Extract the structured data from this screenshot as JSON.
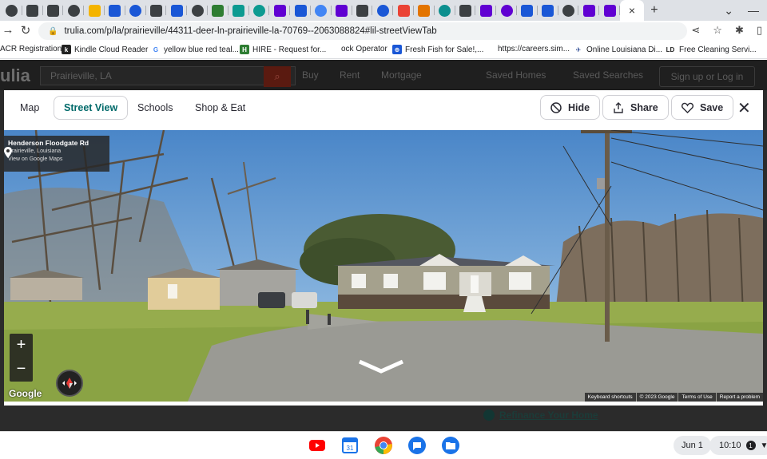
{
  "browser": {
    "tab_colors": [
      "#3c4043",
      "#3c4043",
      "#3c4043",
      "#3c4043",
      "#f4b400",
      "#1a57d6",
      "#1a57d6",
      "#3c4043",
      "#1a57d6",
      "#3c4043",
      "#2e7d32",
      "#0c9a91",
      "#0c9a91",
      "#6001d2",
      "#1a57d6",
      "#4285f4",
      "#6001d2",
      "#3c4043",
      "#1a57d6",
      "#ea4335",
      "#e37400",
      "#0c8f8f",
      "#3c4043",
      "#6001d2",
      "#6001d2",
      "#1a57d6",
      "#1a57d6",
      "#3c4043",
      "#6001d2",
      "#6001d2"
    ],
    "active_tab_close": "×",
    "new_tab": "+",
    "url_host": "trulia.com",
    "url_path": "/p/la/prairieville/44311-deer-ln-prairieville-la-70769--2063088824#lil-streetViewTab",
    "bookmarks": [
      {
        "label": "ACR Registration",
        "color": "#3c4043"
      },
      {
        "label": "Kindle Cloud Reader",
        "color": "#222222",
        "icon": "k"
      },
      {
        "label": "yellow blue red teal...",
        "color": "#4285f4",
        "icon": "G"
      },
      {
        "label": "HIRE - Request for...",
        "color": "#2e7d32",
        "icon": "H"
      },
      {
        "label": "ock Operator",
        "color": "#ffffff"
      },
      {
        "label": "Fresh Fish for Sale!,...",
        "color": "#1a57d6",
        "icon": "⊕"
      },
      {
        "label": "https://careers.sim...",
        "color": "#ffffff"
      },
      {
        "label": "Online Louisiana Di...",
        "color": "#1a3a8a",
        "icon": "✈"
      },
      {
        "label": "Free Cleaning Servi...",
        "color": "#222222",
        "icon": "LD"
      }
    ]
  },
  "trulia": {
    "logo": "ulia",
    "search_value": "Prairieville, LA",
    "nav": [
      "Buy",
      "Rent",
      "Mortgage",
      "Saved Homes",
      "Saved Searches"
    ],
    "signup": "Sign up or Log in",
    "refinance": "Refinance Your Home"
  },
  "modal": {
    "tabs": [
      "Map",
      "Street View",
      "Schools",
      "Shop & Eat"
    ],
    "active_tab": "Street View",
    "hide": "Hide",
    "share": "Share",
    "save": "Save"
  },
  "street_view": {
    "road": "Henderson Floodgate Rd",
    "city": "Prairieville, Louisiana",
    "maps_link": "View on Google Maps",
    "google": "Google",
    "footer": [
      "Keyboard shortcuts",
      "© 2023 Google",
      "Terms of Use",
      "Report a problem"
    ],
    "zoom_in": "+",
    "zoom_out": "−"
  },
  "shelf": {
    "apps": [
      {
        "name": "youtube",
        "color": "#ff0000"
      },
      {
        "name": "calendar",
        "color": "#1a73e8"
      },
      {
        "name": "chrome",
        "color": "#34a853"
      },
      {
        "name": "messages",
        "color": "#1a73e8"
      },
      {
        "name": "files",
        "color": "#1a73e8"
      }
    ],
    "date": "Jun 1",
    "time": "10:10",
    "notif": "1"
  }
}
